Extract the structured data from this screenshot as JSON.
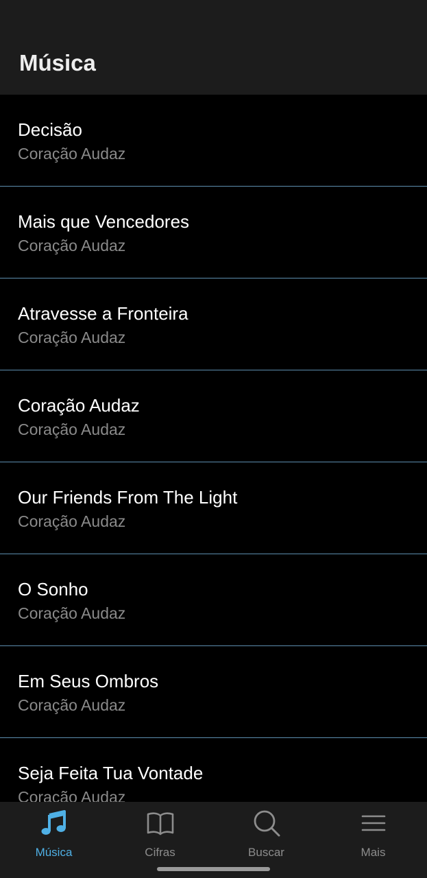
{
  "app_bar": {
    "title": "Música"
  },
  "songs": [
    {
      "title": "Decisão",
      "artist": "Coração Audaz"
    },
    {
      "title": "Mais que Vencedores",
      "artist": "Coração Audaz"
    },
    {
      "title": "Atravesse a Fronteira",
      "artist": "Coração Audaz"
    },
    {
      "title": "Coração Audaz",
      "artist": "Coração Audaz"
    },
    {
      "title": "Our Friends From The Light",
      "artist": "Coração Audaz"
    },
    {
      "title": "O Sonho",
      "artist": "Coração Audaz"
    },
    {
      "title": "Em Seus Ombros",
      "artist": "Coração Audaz"
    },
    {
      "title": "Seja Feita Tua Vontade",
      "artist": "Coração Audaz"
    }
  ],
  "tab_bar": {
    "tabs": [
      {
        "label": "Música",
        "icon": "music-note-icon",
        "active": true
      },
      {
        "label": "Cifras",
        "icon": "book-icon",
        "active": false
      },
      {
        "label": "Buscar",
        "icon": "search-icon",
        "active": false
      },
      {
        "label": "Mais",
        "icon": "menu-icon",
        "active": false
      }
    ]
  },
  "colors": {
    "accent": "#4fb0e5",
    "divider": "#5d8fb0",
    "bar_background": "#1c1c1c",
    "list_background": "#000000",
    "secondary_text": "#8a8a8a"
  }
}
